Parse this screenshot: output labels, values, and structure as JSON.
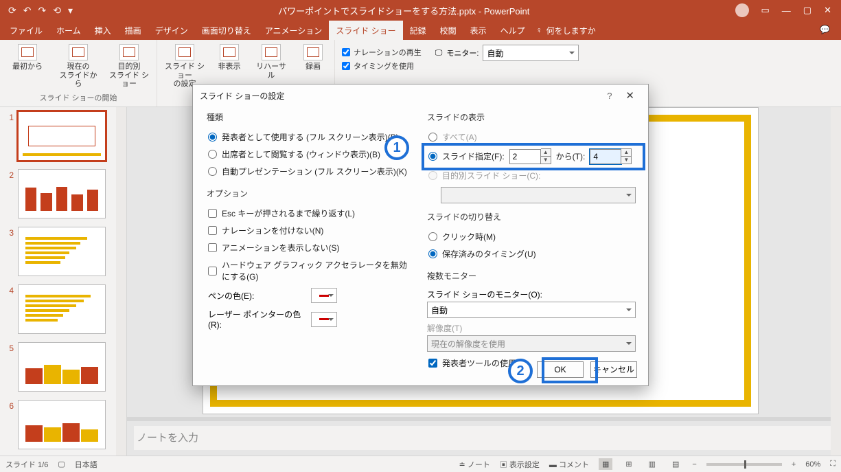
{
  "title": "パワーポイントでスライドショーをする方法.pptx  -  PowerPoint",
  "tabs": [
    "ファイル",
    "ホーム",
    "挿入",
    "描画",
    "デザイン",
    "画面切り替え",
    "アニメーション",
    "スライド ショー",
    "記録",
    "校閲",
    "表示",
    "ヘルプ"
  ],
  "active_tab": "スライド ショー",
  "tell_me": "何をしますか",
  "ribbon": {
    "start": {
      "label": "スライド ショーの開始",
      "from_begin": "最初から",
      "from_current": "現在の\nスライドから",
      "custom": "目的別\nスライド ショー"
    },
    "setup": {
      "slideshow_settings": "スライド ショー\nの設定",
      "hide": "非表示",
      "rehearse": "リハーサル",
      "record": "録画",
      "chk_narration": "ナレーションの再生",
      "chk_timing": "タイミングを使用"
    },
    "monitor": {
      "label": "モニター:",
      "value": "自動"
    }
  },
  "thumbs": [
    1,
    2,
    3,
    4,
    5,
    6
  ],
  "notes_placeholder": "ノートを入力",
  "status": {
    "slide": "スライド 1/6",
    "lang": "日本語",
    "notes": "ノート",
    "display": "表示設定",
    "comments": "コメント",
    "zoom": "60%"
  },
  "dialog": {
    "title": "スライド ショーの設定",
    "type": {
      "label": "種類",
      "presenter": "発表者として使用する (フル スクリーン表示)(P)",
      "browsed": "出席者として閲覧する (ウィンドウ表示)(B)",
      "kiosk": "自動プレゼンテーション (フル スクリーン表示)(K)"
    },
    "options": {
      "label": "オプション",
      "loop": "Esc キーが押されるまで繰り返す(L)",
      "no_narration": "ナレーションを付けない(N)",
      "no_anim": "アニメーションを表示しない(S)",
      "hw": "ハードウェア グラフィック アクセラレータを無効にする(G)",
      "pen": "ペンの色(E):",
      "laser": "レーザー ポインターの色(R):"
    },
    "show": {
      "label": "スライドの表示",
      "all": "すべて(A)",
      "range": "スライド指定(F):",
      "from_val": "2",
      "to_label": "から(T):",
      "to_val": "4",
      "custom": "目的別スライド ショー(C):"
    },
    "advance": {
      "label": "スライドの切り替え",
      "manual": "クリック時(M)",
      "timing": "保存済みのタイミング(U)"
    },
    "multi": {
      "label": "複数モニター",
      "monitor_label": "スライド ショーのモニター(O):",
      "monitor_val": "自動",
      "res_label": "解像度(T)",
      "res_val": "現在の解像度を使用",
      "presenter_view": "発表者ツールの使用(V)"
    },
    "ok": "OK",
    "cancel": "キャンセル"
  },
  "annot": {
    "one": "1",
    "two": "2"
  }
}
